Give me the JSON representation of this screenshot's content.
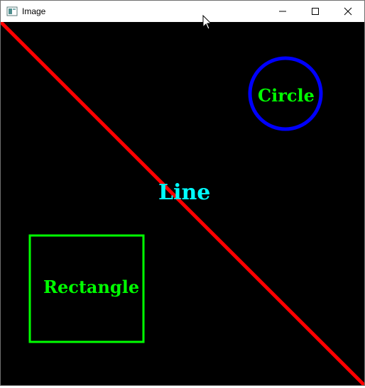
{
  "window": {
    "title": "Image",
    "icon": "image-window-icon",
    "controls": {
      "minimize_icon": "minimize-icon",
      "maximize_icon": "maximize-icon",
      "close_icon": "close-icon"
    }
  },
  "canvas": {
    "background": "#000000",
    "line": {
      "label": "Line",
      "color": "#ff0000",
      "label_color": "#00ffff"
    },
    "circle": {
      "label": "Circle",
      "color": "#0000ff",
      "label_color": "#00ff00"
    },
    "rectangle": {
      "label": "Rectangle",
      "color": "#00ff00",
      "label_color": "#00ff00"
    }
  },
  "cursor": {
    "icon": "mouse-pointer-icon"
  }
}
